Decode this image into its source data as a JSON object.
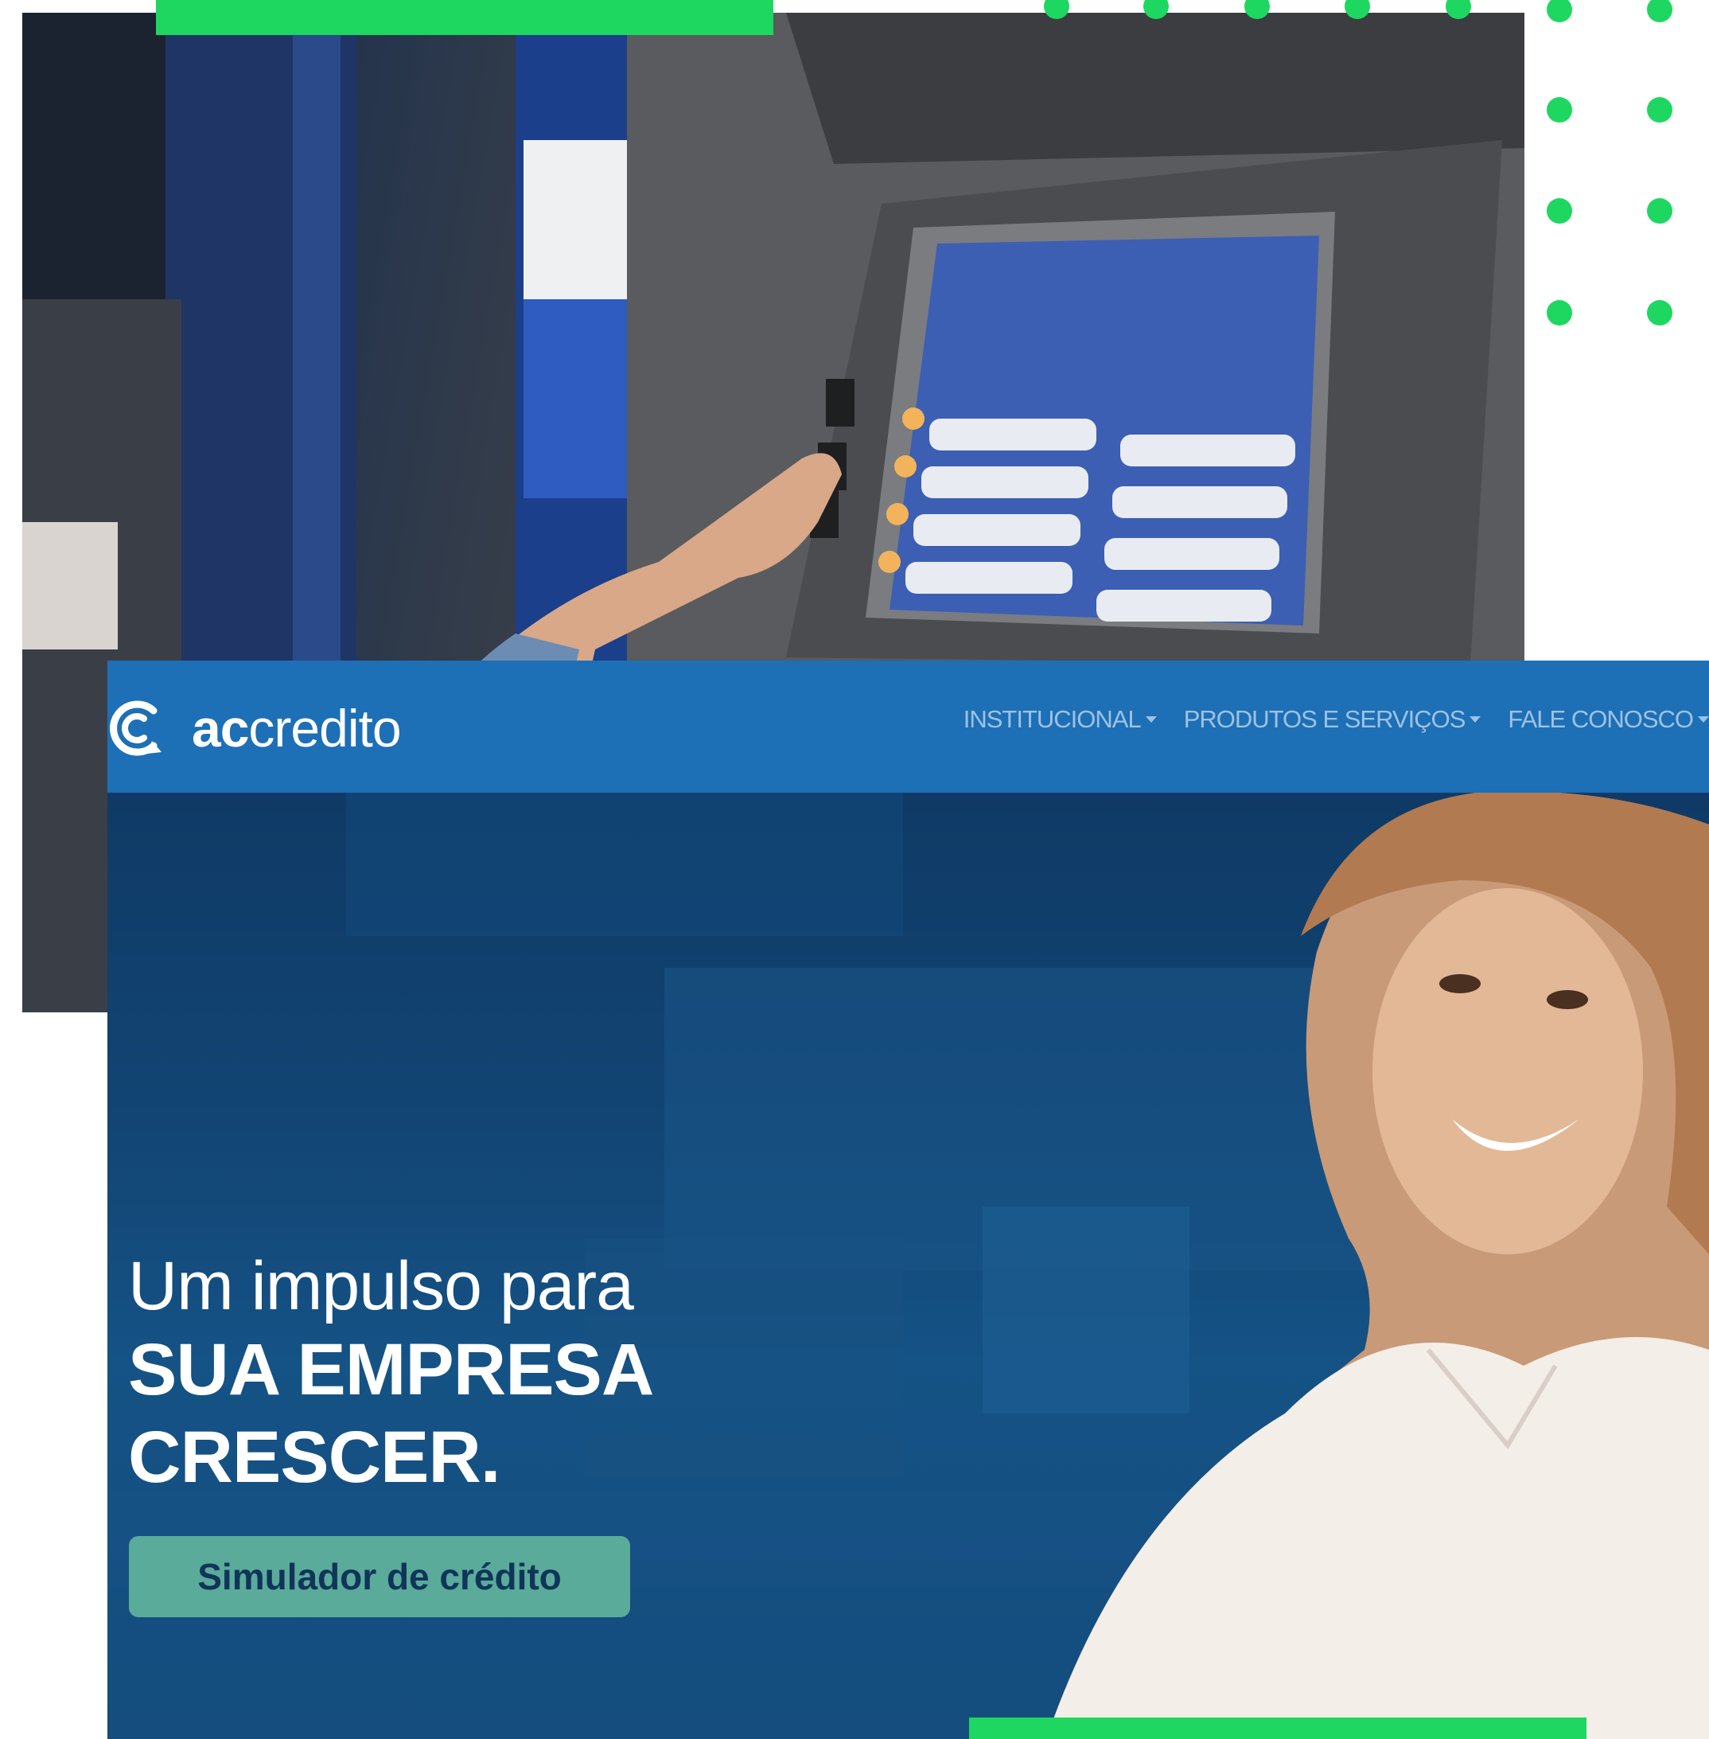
{
  "site": {
    "brand": {
      "bold": "ac",
      "regular": "credito"
    },
    "nav": {
      "items": [
        {
          "label": "INSTITUCIONAL"
        },
        {
          "label": "PRODUTOS E SERVIÇOS"
        },
        {
          "label": "FALE CONOSCO"
        }
      ]
    },
    "hero": {
      "line1": "Um impulso para",
      "line2": "SUA EMPRESA",
      "line3": "CRESCER.",
      "cta_label": "Simulador de crédito"
    }
  },
  "colors": {
    "accent_green": "#1ed760",
    "nav_blue": "#1d6fb6",
    "hero_blue": "#124574",
    "cta_teal": "#5aab99"
  },
  "icons": {
    "brand_logo": "accredito-c-logo-icon",
    "dropdown": "chevron-down-icon"
  }
}
